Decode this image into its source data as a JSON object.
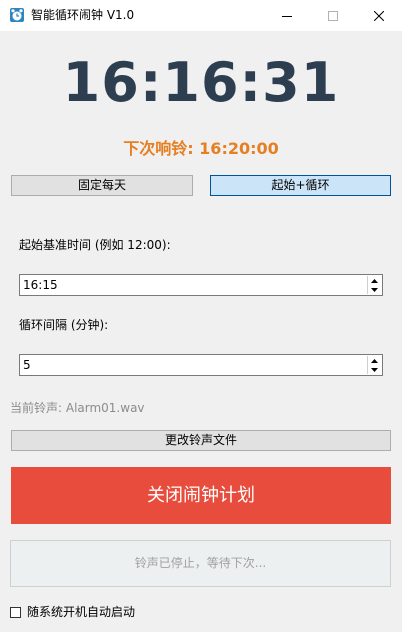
{
  "window": {
    "title": "智能循环闹钟 V1.0",
    "icon": "alarm-clock-icon",
    "controls": [
      "minimize-icon",
      "maximize-icon",
      "close-icon"
    ]
  },
  "clock": {
    "time": "16:16:31",
    "color": "#2c3e50"
  },
  "next_alarm": {
    "text": "下次响铃: 16:20:00",
    "color": "#e67e22"
  },
  "modes": {
    "fixed_label": "固定每天",
    "cycle_label": "起始+循环",
    "selected": "起始+循环"
  },
  "start_time": {
    "label": "起始基准时间 (例如 12:00):",
    "value": "16:15"
  },
  "interval": {
    "label": "循环间隔 (分钟):",
    "value": "5"
  },
  "sound": {
    "text": "当前铃声: Alarm01.wav"
  },
  "buttons": {
    "change_sound": "更改铃声文件",
    "stop_plan": "关闭闹钟计划",
    "stop_color": "#e74c3c",
    "status": "铃声已停止，等待下次..."
  },
  "autostart": {
    "label": "随系统开机自动启动",
    "checked": false
  }
}
